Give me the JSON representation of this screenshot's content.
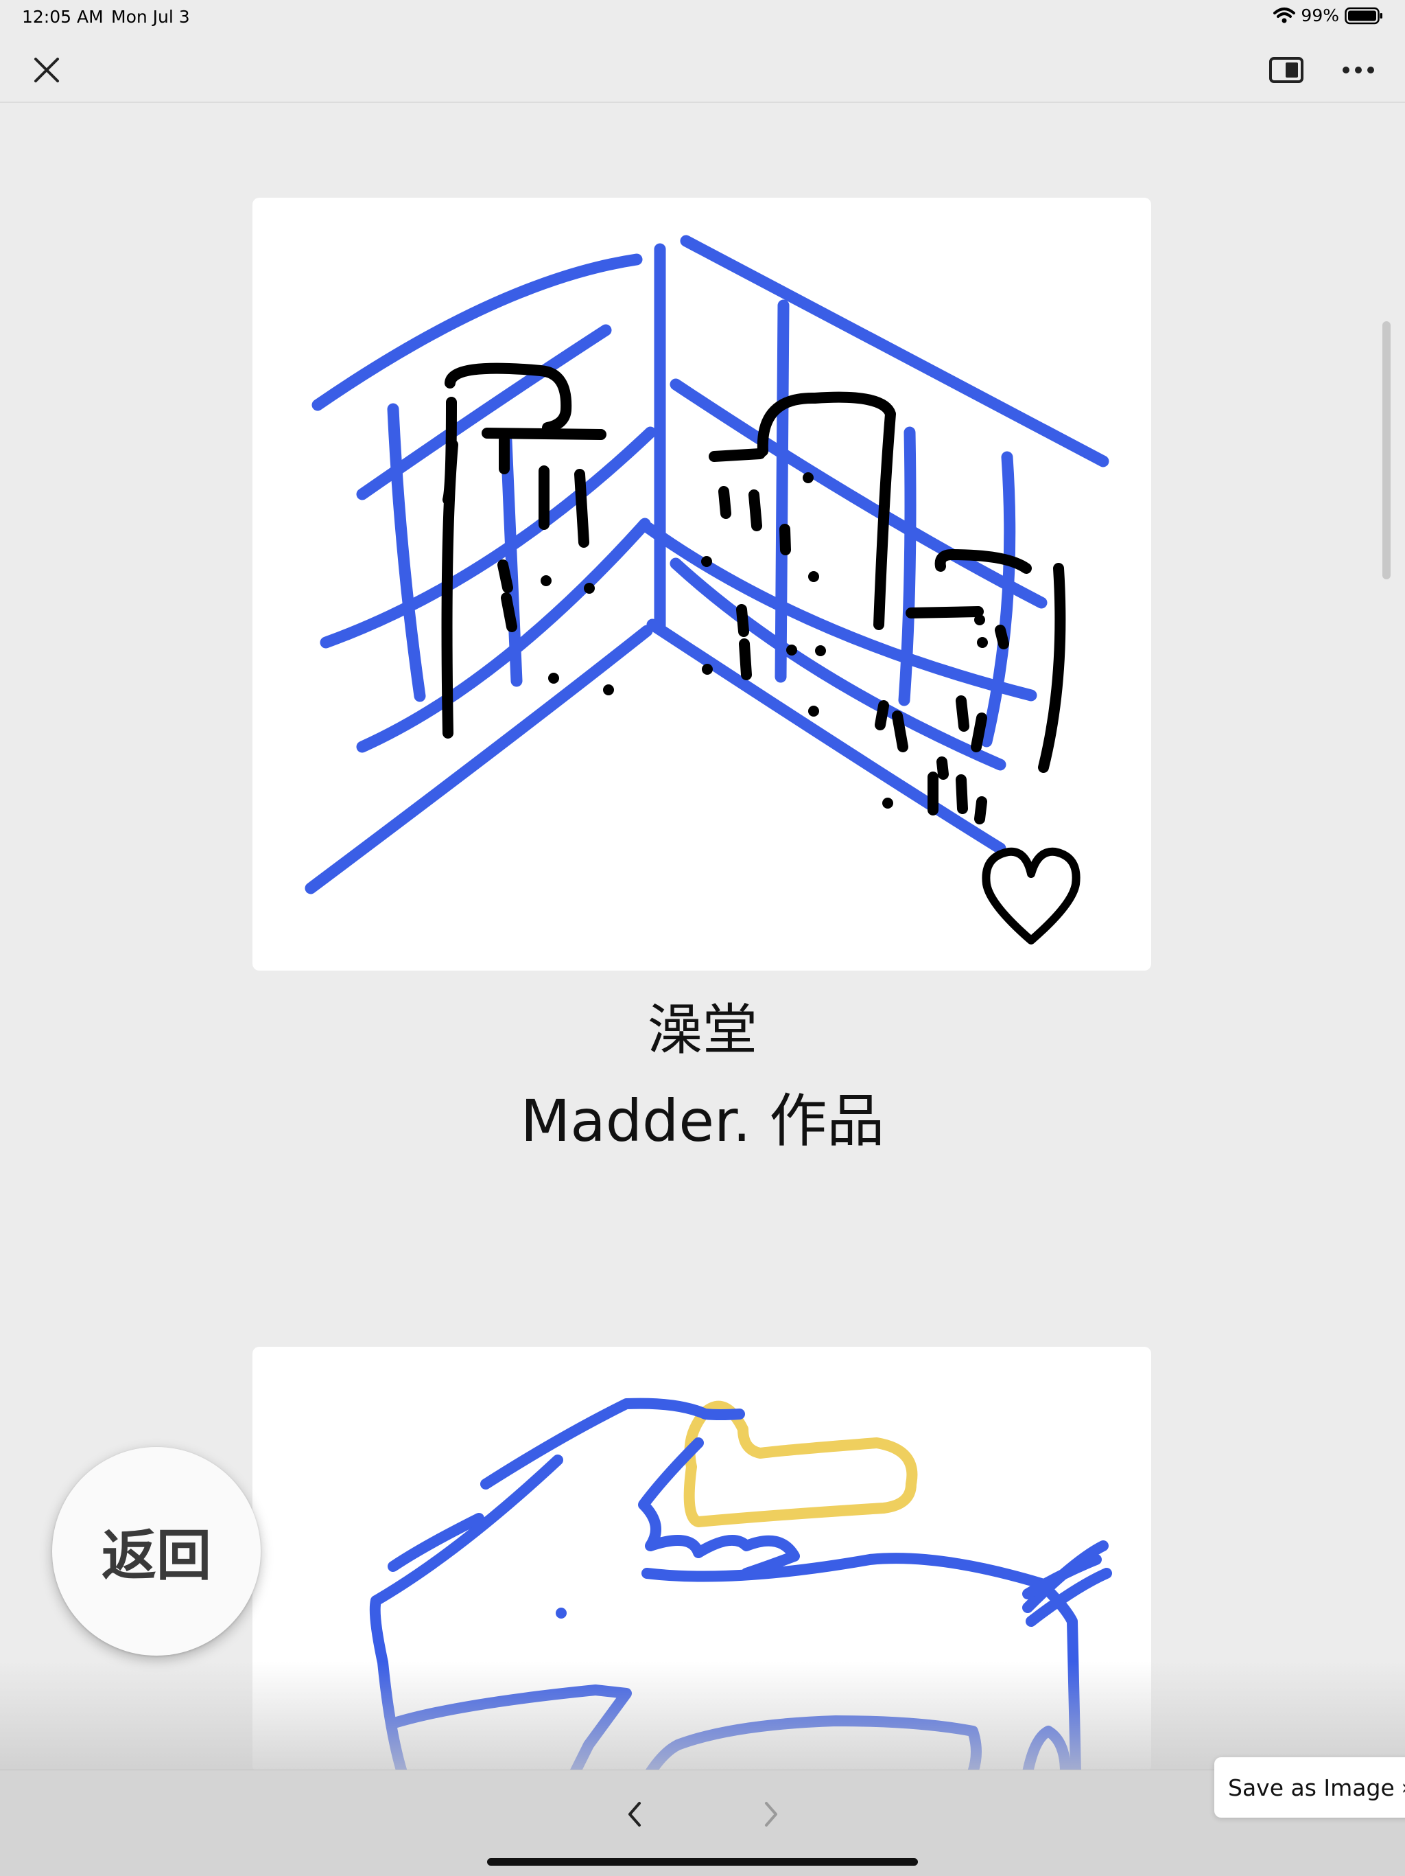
{
  "status": {
    "time": "12:05 AM",
    "date": "Mon Jul 3",
    "battery": "99%"
  },
  "work": {
    "title": "澡堂",
    "author": "Madder. 作品"
  },
  "back_button": {
    "label": "返回"
  },
  "save_image": {
    "label": "Save as Image"
  },
  "icons": {
    "close": "close-icon",
    "sidebar": "sidebar-toggle-icon",
    "more": "more-icon",
    "nav_back": "chevron-left-icon",
    "nav_forward": "chevron-right-icon",
    "heart": "heart-icon",
    "wifi": "wifi-icon",
    "battery": "battery-icon"
  },
  "colors": {
    "ink_blue": "#3a5ee6",
    "ink_black": "#000000",
    "ink_yellow": "#efcf5e",
    "background": "#ececec"
  }
}
